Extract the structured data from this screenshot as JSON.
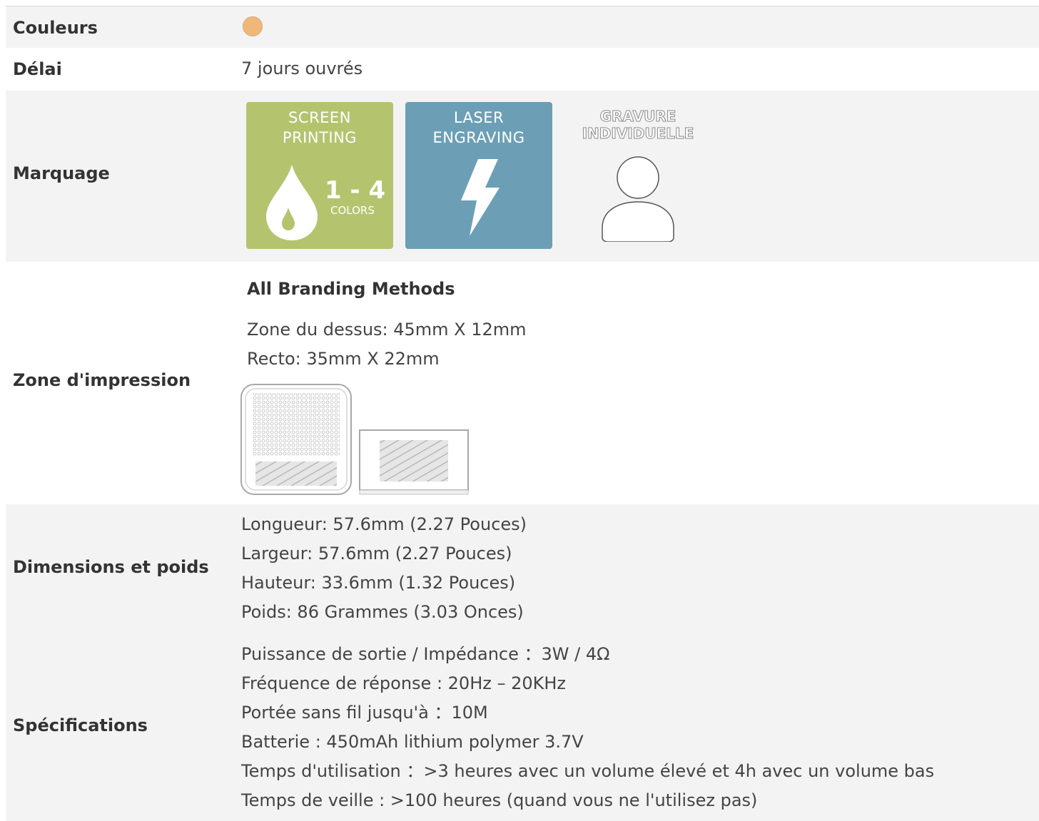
{
  "rows": {
    "colors": {
      "label": "Couleurs",
      "swatch_color": "#f0b878"
    },
    "lead_time": {
      "label": "Délai",
      "value": "7 jours ouvrés"
    },
    "branding": {
      "label": "Marquage",
      "screen_printing": {
        "title_line1": "SCREEN",
        "title_line2": "PRINTING",
        "count": "1 - 4",
        "count_unit": "COLORS",
        "color": "#b4c46e",
        "icon": "ink-drop-icon"
      },
      "laser_engraving": {
        "title_line1": "LASER",
        "title_line2": "ENGRAVING",
        "color": "#6c9fb6",
        "icon": "lightning-bolt-icon"
      },
      "individual_engraving": {
        "title_line1": "GRAVURE",
        "title_line2": "INDIVIDUELLE",
        "icon": "person-icon"
      }
    },
    "print_area": {
      "label": "Zone d'impression",
      "heading": "All Branding Methods",
      "lines": [
        "Zone du dessus: 45mm X 12mm",
        "Recto: 35mm X 22mm"
      ]
    },
    "dimensions": {
      "label": "Dimensions et poids",
      "lines": [
        "Longueur: 57.6mm (2.27 Pouces)",
        "Largeur: 57.6mm (2.27 Pouces)",
        "Hauteur: 33.6mm (1.32 Pouces)",
        "Poids: 86 Grammes (3.03 Onces)"
      ]
    },
    "specs": {
      "label": "Spécifications",
      "lines": [
        "Puissance de sortie / Impédance ：3W / 4Ω",
        "Fréquence de réponse : 20Hz – 20KHz",
        "Portée sans fil jusqu'à ：10M",
        "Batterie : 450mAh lithium polymer 3.7V",
        "Temps d'utilisation ：>3 heures avec un volume élevé et 4h avec un volume bas",
        "Temps de veille : >100 heures (quand vous ne l'utilisez pas)"
      ]
    }
  }
}
